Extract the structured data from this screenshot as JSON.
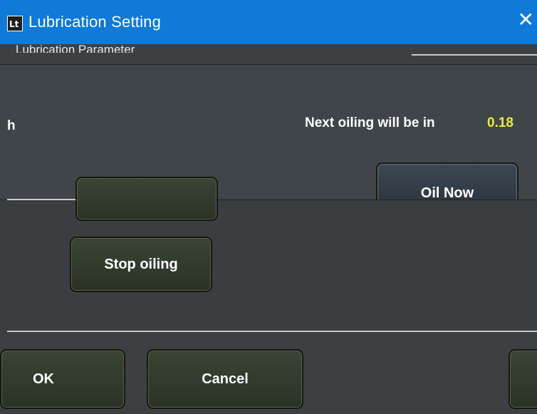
{
  "window": {
    "title": "Lubrication Setting",
    "close_symbol": "✕"
  },
  "top_group": {
    "label": "Lubrication Parameter"
  },
  "parameters": {
    "unit_h": "h",
    "next_oiling_label": "Next oiling will be in",
    "next_oiling_value": "0.18"
  },
  "buttons": {
    "oil_now": "Oil Now",
    "stop_oiling": "Stop oiling",
    "ok": "OK",
    "cancel": "Cancel"
  },
  "colors": {
    "titlebar": "#0f7ad8",
    "value_highlight": "#ecec3c",
    "background": "#3c4043"
  }
}
